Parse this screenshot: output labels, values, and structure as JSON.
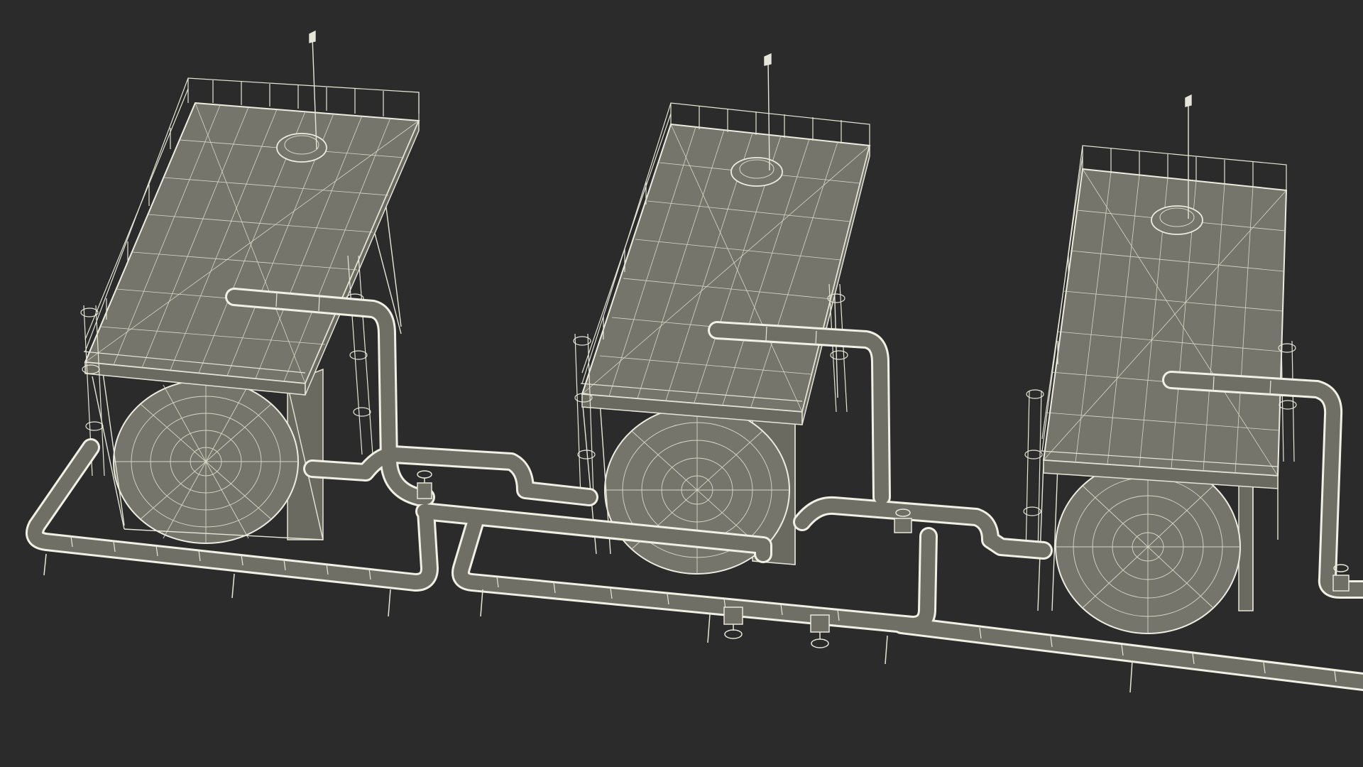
{
  "scene": {
    "title": "",
    "description_visible_text": "",
    "colors": {
      "background": "#2b2b2b",
      "wire": "#e6e6d8",
      "surface": "#75756b",
      "pipe_outline": "#f0f0e4",
      "pipe_fill": "#6f6f66"
    },
    "objects": [
      {
        "name": "storage-tank-1",
        "parts": [
          "roof-deck",
          "railing",
          "manhole-hatch",
          "vent-antenna",
          "ladder",
          "spherical-end",
          "support-frame"
        ]
      },
      {
        "name": "storage-tank-2",
        "parts": [
          "roof-deck",
          "railing",
          "manhole-hatch",
          "vent-antenna",
          "ladder",
          "spherical-end",
          "support-frame"
        ]
      },
      {
        "name": "storage-tank-3",
        "parts": [
          "roof-deck",
          "railing",
          "manhole-hatch",
          "vent-antenna",
          "ladder",
          "spherical-end",
          "support-frame"
        ]
      },
      {
        "name": "pipe-network",
        "parts": [
          "main-header",
          "loops",
          "valves",
          "pipe-supports"
        ]
      }
    ]
  }
}
